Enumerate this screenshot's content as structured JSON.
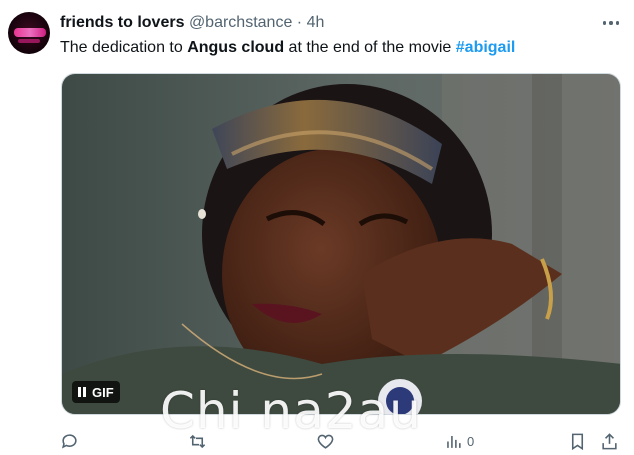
{
  "user": {
    "display_name": "friends to lovers",
    "handle": "@barchstance",
    "separator": "·",
    "time": "4h",
    "avatar": "profile-avatar"
  },
  "tweet": {
    "text_prefix": "The dedication to ",
    "text_bold": "Angus cloud",
    "text_middle": " at the end of the movie ",
    "hashtag": "#abigail"
  },
  "media": {
    "type": "gif",
    "badge_label": "GIF",
    "pause_icon": "pause-icon"
  },
  "actions": {
    "views_count": "0",
    "icons": [
      "reply-icon",
      "retweet-icon",
      "like-icon",
      "views-icon",
      "bookmark-icon",
      "share-icon"
    ]
  },
  "watermark": "Chi na2au",
  "colors": {
    "accent": "#1d9bf0",
    "secondary_text": "#536471",
    "primary_text": "#0f1419"
  }
}
